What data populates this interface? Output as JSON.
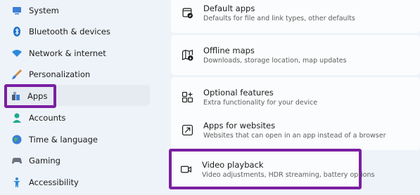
{
  "sidebar": {
    "items": [
      {
        "label": "System",
        "icon": "system-icon"
      },
      {
        "label": "Bluetooth & devices",
        "icon": "bluetooth-icon"
      },
      {
        "label": "Network & internet",
        "icon": "wifi-icon"
      },
      {
        "label": "Personalization",
        "icon": "brush-icon"
      },
      {
        "label": "Apps",
        "icon": "apps-icon"
      },
      {
        "label": "Accounts",
        "icon": "accounts-icon"
      },
      {
        "label": "Time & language",
        "icon": "globe-icon"
      },
      {
        "label": "Gaming",
        "icon": "gaming-icon"
      },
      {
        "label": "Accessibility",
        "icon": "accessibility-icon"
      }
    ],
    "selected": "Apps"
  },
  "main": {
    "cards": [
      {
        "title": "Default apps",
        "description": "Defaults for file and link types, other defaults",
        "icon": "default-apps-icon"
      },
      {
        "title": "Offline maps",
        "description": "Downloads, storage location, map updates",
        "icon": "offline-maps-icon"
      },
      {
        "title": "Optional features",
        "description": "Extra functionality for your device",
        "icon": "optional-features-icon"
      },
      {
        "title": "Apps for websites",
        "description": "Websites that can open in an app instead of a browser",
        "icon": "apps-for-websites-icon"
      },
      {
        "title": "Video playback",
        "description": "Video adjustments, HDR streaming, battery options",
        "icon": "video-camera-icon"
      }
    ]
  },
  "colors": {
    "background": "#eef3f9",
    "card": "#fbfcfd",
    "highlight": "#7a1fa2",
    "selected": "#e6ebf1"
  }
}
